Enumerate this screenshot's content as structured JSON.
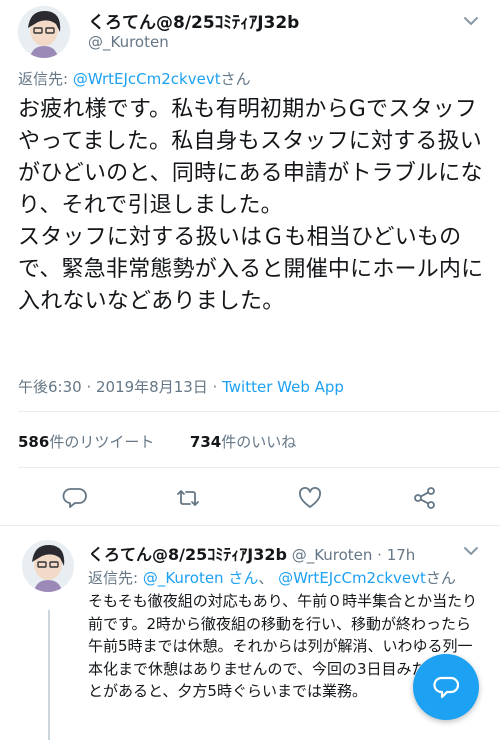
{
  "tweet": {
    "display_name": "くろてん@8/25ｺﾐﾃｨｱJ32b",
    "handle": "@_Kuroten",
    "reply_prefix": "返信先: ",
    "reply_to_user": "@WrtEJcCm2ckvevt",
    "reply_suffix": "さん",
    "paragraph1": "お疲れ様です。私も有明初期からGでスタッフやってました。私自身もスタッフに対する扱いがひどいのと、同時にある申請がトラブルになり、それで引退しました。",
    "paragraph2": "スタッフに対する扱いはＧも相当ひどいもので、緊急非常態勢が入ると開催中にホール内に入れないなどありました。",
    "time": "午後6:30 · 2019年8月13日 · ",
    "source": "Twitter Web App",
    "retweet_count": "586",
    "retweet_label": "件のリツイート",
    "like_count": "734",
    "like_label": "件のいいね"
  },
  "reply": {
    "display_name": "くろてん@8/25ｺﾐﾃｨｱJ32b",
    "handle_time": " @_Kuroten · 17h",
    "reply_prefix": "返信先: ",
    "reply_to_user1": "@_Kuroten さん",
    "reply_sep": "、 ",
    "reply_to_user2": "@WrtEJcCm2ckvevt",
    "reply_suffix": "さん",
    "body": "そもそも徹夜組の対応もあり、午前０時半集合とか当たり前です。2時から徹夜組の移動を行い、移動が終わったら午前5時までは休憩。それからは列が解消、いわゆる列一本化まで休憩はありませんので、今回の3日目みたいなことがあると、夕方5時ぐらいまでは業務。"
  },
  "icons": {
    "caret": "chevron-down-icon",
    "reply": "reply-icon",
    "retweet": "retweet-icon",
    "like": "heart-icon",
    "share": "share-icon",
    "compose": "compose-icon"
  },
  "colors": {
    "accent": "#1da1f2",
    "secondary_text": "#657786",
    "primary_text": "#14171a",
    "divider": "#e6ecf0"
  }
}
